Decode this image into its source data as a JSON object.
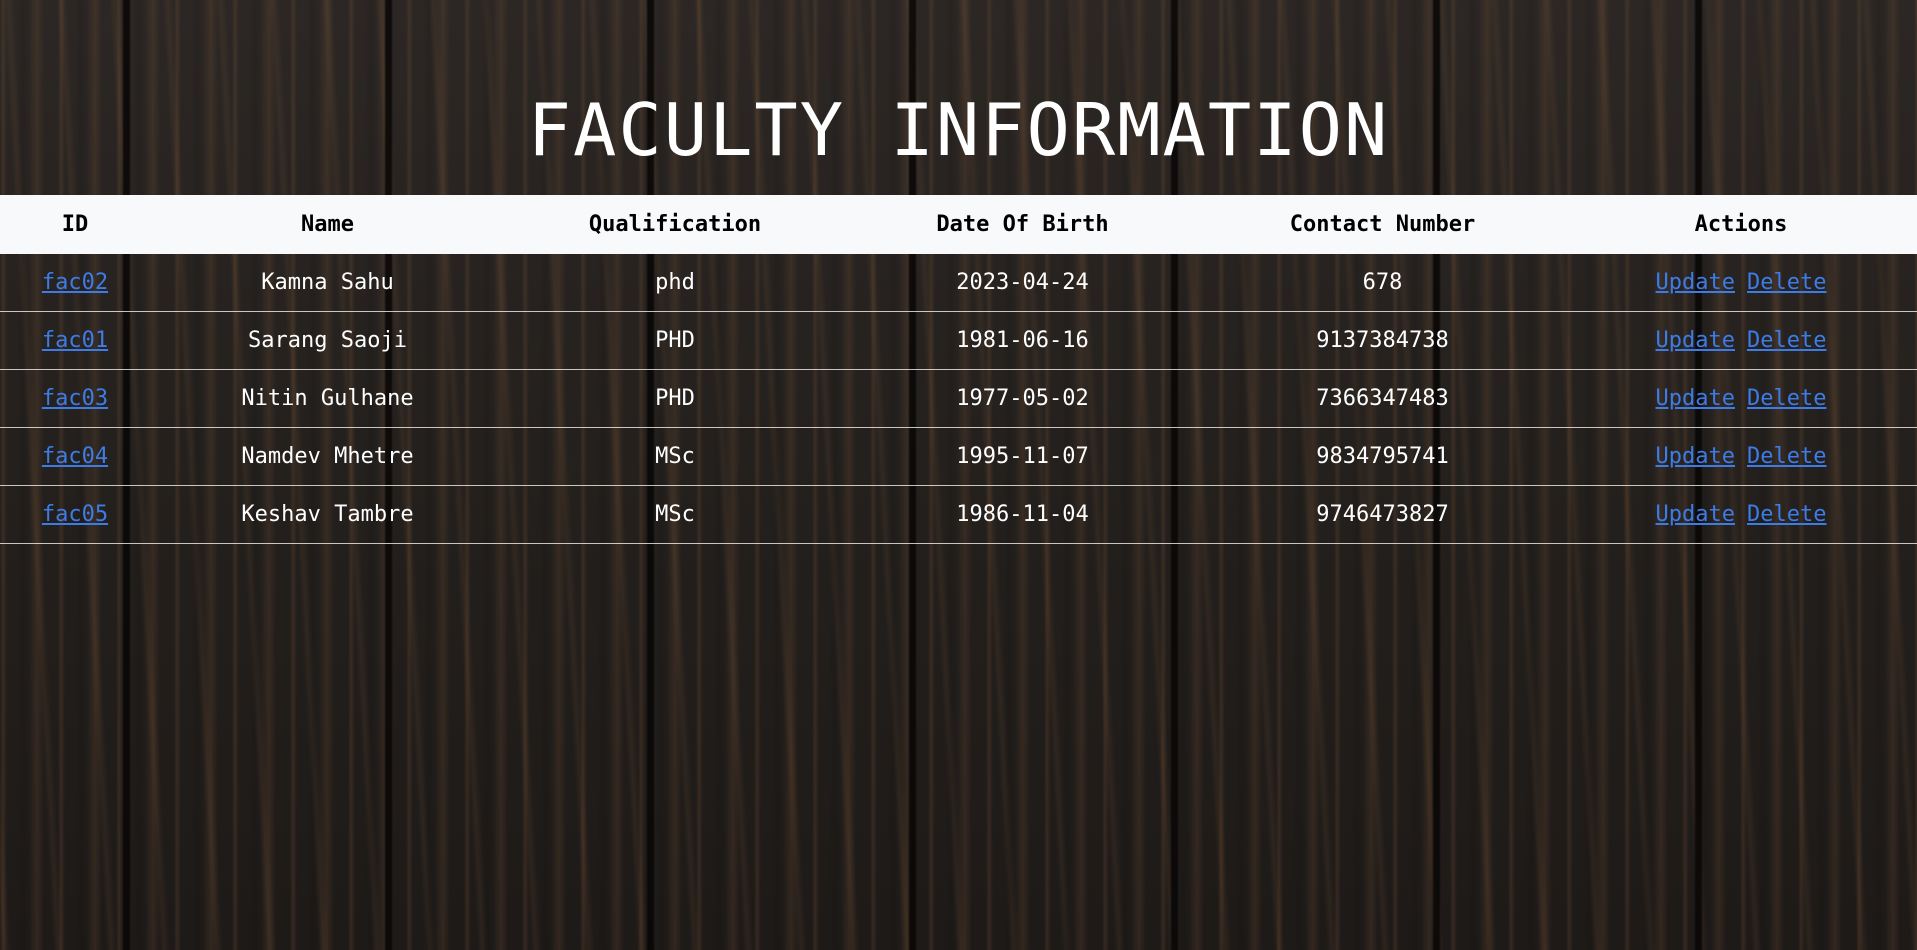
{
  "page": {
    "title": "FACULTY INFORMATION"
  },
  "table": {
    "headers": [
      "ID",
      "Name",
      "Qualification",
      "Date Of Birth",
      "Contact Number",
      "Actions"
    ],
    "rows": [
      {
        "id": "fac02",
        "name": "Kamna Sahu",
        "qualification": "phd",
        "dob": "2023-04-24",
        "contact": "678",
        "update": "Update",
        "delete": "Delete"
      },
      {
        "id": "fac01",
        "name": "Sarang Saoji",
        "qualification": "PHD",
        "dob": "1981-06-16",
        "contact": "9137384738",
        "update": "Update",
        "delete": "Delete"
      },
      {
        "id": "fac03",
        "name": "Nitin Gulhane",
        "qualification": "PHD",
        "dob": "1977-05-02",
        "contact": "7366347483",
        "update": "Update",
        "delete": "Delete"
      },
      {
        "id": "fac04",
        "name": "Namdev Mhetre",
        "qualification": "MSc",
        "dob": "1995-11-07",
        "contact": "9834795741",
        "update": "Update",
        "delete": "Delete"
      },
      {
        "id": "fac05",
        "name": "Keshav Tambre",
        "qualification": "MSc",
        "dob": "1986-11-04",
        "contact": "9746473827",
        "update": "Update",
        "delete": "Delete"
      }
    ]
  },
  "colors": {
    "header_bg": "#f8f9fa",
    "link": "#3d7be6",
    "text": "#ffffff",
    "background": "#26221f"
  }
}
